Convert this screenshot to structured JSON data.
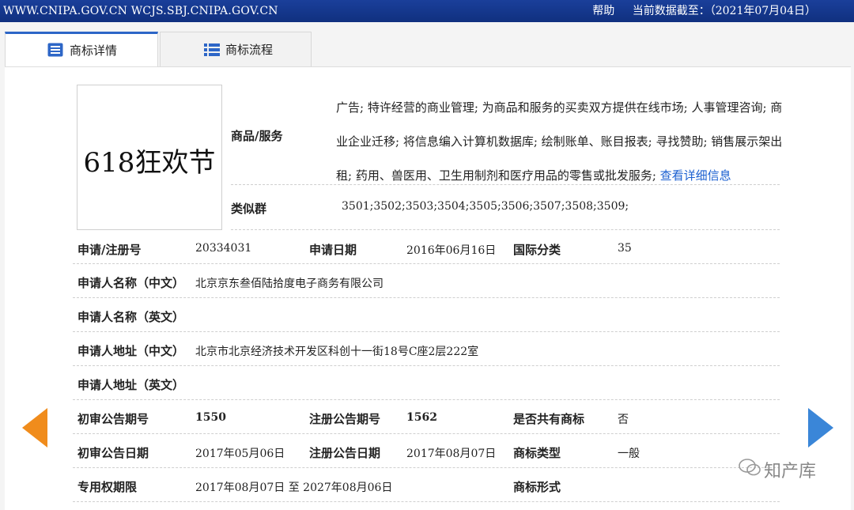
{
  "topbar": {
    "site": "WWW.CNIPA.GOV.CN WCJS.SBJ.CNIPA.GOV.CN",
    "help": "帮助",
    "data_as_of": "当前数据截至：（2021年07月04日）"
  },
  "tabs": [
    {
      "label": "商标详情",
      "active": true
    },
    {
      "label": "商标流程",
      "active": false
    }
  ],
  "trademark": {
    "logo_text": "618狂欢节",
    "goods_label": "商品/服务",
    "goods_lines": [
      "广告; 特许经营的商业管理; 为商品和服务的买卖双方提供在线市场; 人事管理咨询; 商",
      "业企业迁移; 将信息编入计算机数据库; 绘制账单、账目报表; 寻找赞助; 销售展示架出",
      "租; 药用、兽医用、卫生用制剂和医疗用品的零售或批发服务; "
    ],
    "goods_more": "查看详细信息",
    "similar_label": "类似群",
    "similar_value": "3501;3502;3503;3504;3505;3506;3507;3508;3509;"
  },
  "fields": {
    "reg_no_label": "申请/注册号",
    "reg_no": "20334031",
    "app_date_label": "申请日期",
    "app_date": "2016年06月16日",
    "intl_class_label": "国际分类",
    "intl_class": "35",
    "applicant_cn_label": "申请人名称（中文）",
    "applicant_cn": "北京京东叁佰陆拾度电子商务有限公司",
    "applicant_en_label": "申请人名称（英文）",
    "applicant_en": "",
    "address_cn_label": "申请人地址（中文）",
    "address_cn": "北京市北京经济技术开发区科创十一街18号C座2层222室",
    "address_en_label": "申请人地址（英文）",
    "address_en": "",
    "prelim_no_label": "初审公告期号",
    "prelim_no": "1550",
    "reg_pub_no_label": "注册公告期号",
    "reg_pub_no": "1562",
    "shared_label": "是否共有商标",
    "shared": "否",
    "prelim_date_label": "初审公告日期",
    "prelim_date": "2017年05月06日",
    "reg_pub_date_label": "注册公告日期",
    "reg_pub_date": "2017年08月07日",
    "tm_type_label": "商标类型",
    "tm_type": "一般",
    "exclusive_label": "专用权期限",
    "exclusive": "2017年08月07日 至 2027年08月06日",
    "tm_form_label": "商标形式",
    "tm_form": ""
  },
  "watermark": "知产库",
  "colors": {
    "topbar": "#10307f",
    "tab_accent": "#2d66c7",
    "link": "#1a5fd0",
    "prev_arrow": "#f08c1c",
    "next_arrow": "#3a86d8"
  },
  "icons": {
    "tab_detail": "document-list-icon",
    "tab_flow": "list-icon",
    "prev": "arrow-left-icon",
    "next": "arrow-right-icon"
  }
}
